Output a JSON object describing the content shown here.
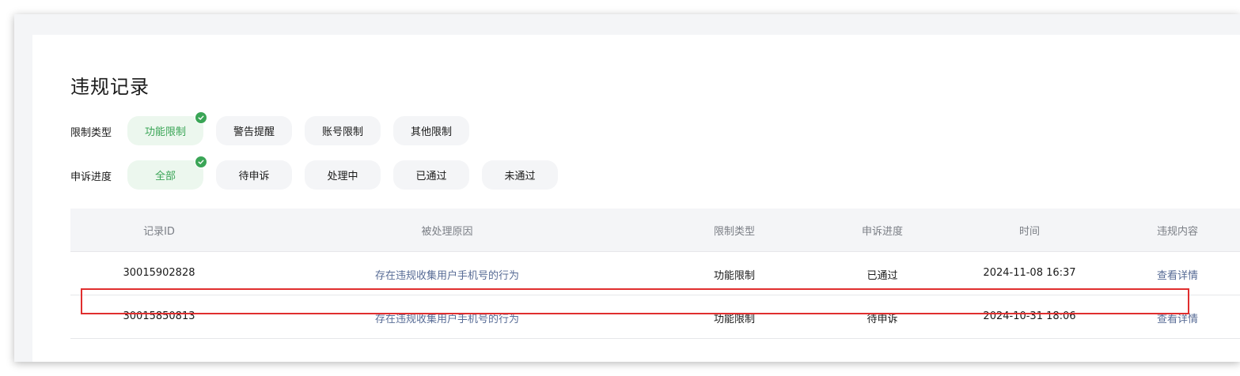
{
  "page": {
    "title": "违规记录"
  },
  "filters": {
    "restriction_type": {
      "label": "限制类型",
      "options": [
        "功能限制",
        "警告提醒",
        "账号限制",
        "其他限制"
      ],
      "selected": "功能限制"
    },
    "appeal_progress": {
      "label": "申诉进度",
      "options": [
        "全部",
        "待申诉",
        "处理中",
        "已通过",
        "未通过"
      ],
      "selected": "全部"
    }
  },
  "table": {
    "columns": [
      "记录ID",
      "被处理原因",
      "限制类型",
      "申诉进度",
      "时间",
      "违规内容"
    ],
    "rows": [
      {
        "id": "30015902828",
        "reason": "存在违规收集用户手机号的行为",
        "type": "功能限制",
        "progress": "已通过",
        "time": "2024-11-08 16:37",
        "action": "查看详情"
      },
      {
        "id": "30015850813",
        "reason": "存在违规收集用户手机号的行为",
        "type": "功能限制",
        "progress": "待申诉",
        "time": "2024-10-31 18:06",
        "action": "查看详情"
      }
    ]
  },
  "colors": {
    "accent": "#3aa556",
    "accent_bg": "#ecf7ee",
    "link": "#576b95",
    "highlight": "#e02e2e"
  },
  "icons": {
    "selected_indicator": "check-circle-icon"
  }
}
